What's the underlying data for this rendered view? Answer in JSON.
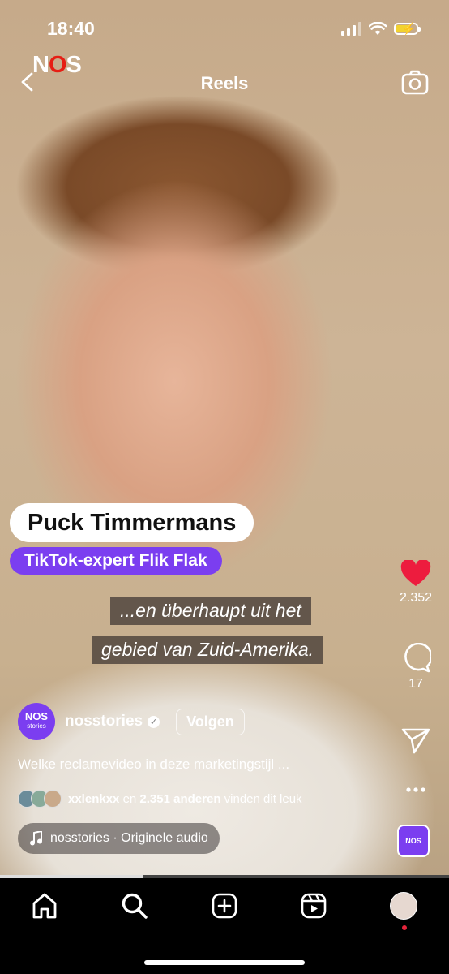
{
  "status_bar": {
    "time": "18:40"
  },
  "header": {
    "logo": "NOS",
    "title": "Reels"
  },
  "overlays": {
    "name_tag": "Puck Timmermans",
    "role_tag": "TikTok-expert Flik Flak",
    "subtitle_line1": "...en überhaupt uit het",
    "subtitle_line2": "gebied van Zuid-Amerika."
  },
  "actions": {
    "likes_count": "2.352",
    "comments_count": "17",
    "like_color": "#ed1c3e"
  },
  "account": {
    "avatar_text": "NOS",
    "avatar_subtext": "stories",
    "username": "nosstories",
    "follow_label": "Volgen"
  },
  "caption": "Welke reclamevideo in deze marketingstijl ...",
  "liked_by": {
    "user": "xxlenkxx",
    "joiner": "en",
    "others": "2.351 anderen",
    "suffix": "vinden dit leuk"
  },
  "audio": {
    "label": "nosstories · Originele audio"
  },
  "playback_progress": 0.32,
  "tabbar": {
    "items": [
      "home-icon",
      "search-icon",
      "create-icon",
      "reels-icon",
      "profile-avatar"
    ]
  },
  "colors": {
    "accent_purple": "#7b3ef0",
    "nos_red": "#e61e14"
  }
}
